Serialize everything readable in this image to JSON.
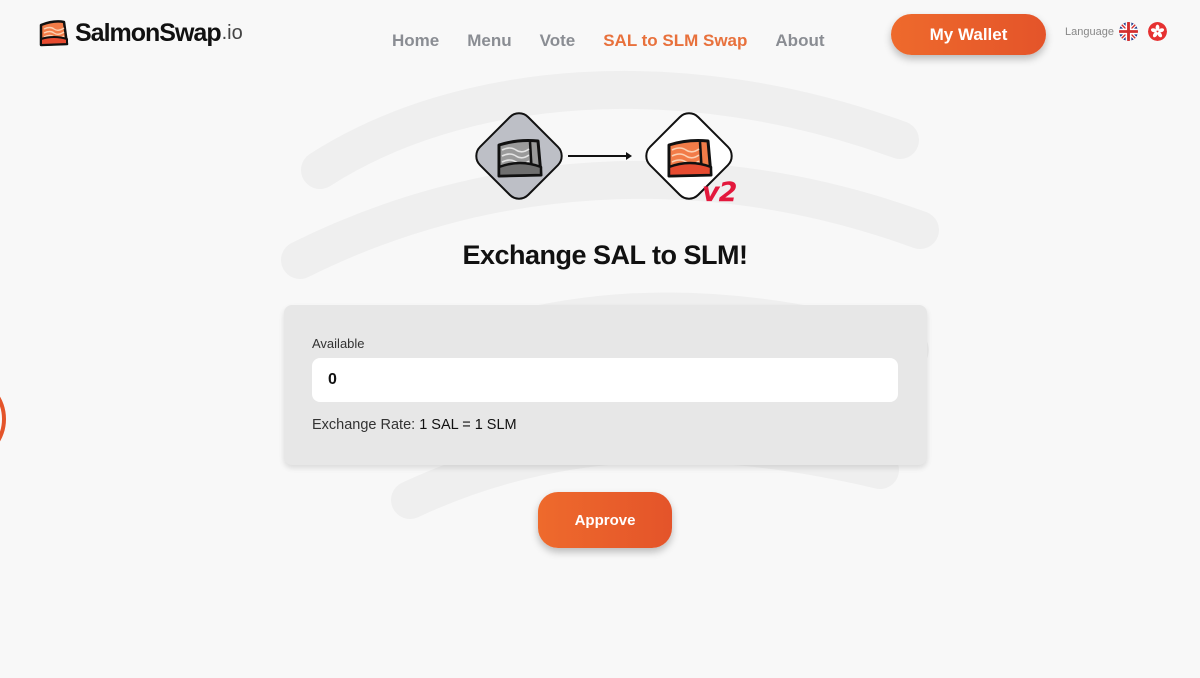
{
  "brand": {
    "name": "SalmonSwap",
    "suffix": ".io"
  },
  "nav": {
    "items": [
      {
        "label": "Home",
        "active": false
      },
      {
        "label": "Menu",
        "active": false
      },
      {
        "label": "Vote",
        "active": false
      },
      {
        "label": "SAL to SLM Swap",
        "active": true
      },
      {
        "label": "About",
        "active": false
      }
    ]
  },
  "header": {
    "wallet_label": "My Wallet",
    "language_label": "Language",
    "languages": [
      "English (UK flag)",
      "Hong Kong flag"
    ]
  },
  "swap": {
    "from_token": "SAL",
    "to_token": "SLM",
    "to_badge": "v2",
    "title": "Exchange SAL to SLM!",
    "available_label": "Available",
    "amount_value": "0",
    "rate_label": "Exchange Rate:",
    "rate_value": "1 SAL = 1 SLM",
    "approve_label": "Approve"
  },
  "colors": {
    "accent": "#e8713c",
    "button": "#ea5f2b",
    "v2_badge": "#e3183c",
    "card_bg": "#e7e7e7",
    "nav_text": "#8a8d93"
  }
}
